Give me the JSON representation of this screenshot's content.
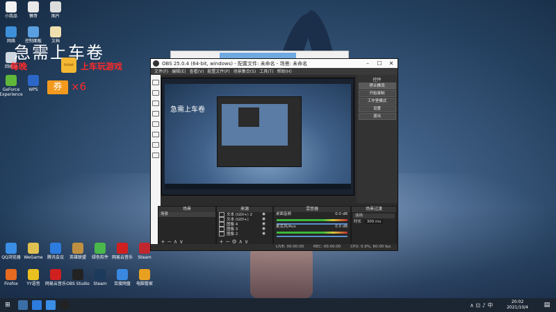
{
  "overlay": {
    "title": "急需上车卷",
    "left_red": "每晚",
    "ticket_label": "ticket",
    "right_red": "上车玩游戏",
    "coupon": "券",
    "multiplier": "×6"
  },
  "desktop_icons_top": [
    {
      "label": "小我品",
      "color": "#f2f2f2"
    },
    {
      "label": "懒哥",
      "color": "#e8e8e8"
    },
    {
      "label": "图片",
      "color": "#ddd"
    }
  ],
  "desktop_icons_left": [
    {
      "label": "网络",
      "color": "#3c8fd8"
    },
    {
      "label": "控制面板",
      "color": "#5aa0e0"
    },
    {
      "label": "文档",
      "color": "#f0e0b0"
    },
    {
      "label": "回收站",
      "color": "#cfd8e0"
    },
    {
      "label": "GeForce Experience",
      "color": "#5fb83a"
    },
    {
      "label": "WPS",
      "color": "#2c66c8"
    }
  ],
  "desktop_icons_bottom1": [
    {
      "label": "QQ浏览器",
      "color": "#3a8ee6"
    },
    {
      "label": "WeGame",
      "color": "#e0c050"
    },
    {
      "label": "腾讯会议",
      "color": "#2d7ce0"
    },
    {
      "label": "英雄联盟",
      "color": "#c09040"
    },
    {
      "label": "绿色软件",
      "color": "#4ab84a"
    },
    {
      "label": "网易云音乐",
      "color": "#d02020"
    },
    {
      "label": "Steam",
      "color": "#c0262e"
    }
  ],
  "desktop_icons_bottom2": [
    {
      "label": "Firefox",
      "color": "#e66a1f"
    },
    {
      "label": "YY语音",
      "color": "#e8c020"
    },
    {
      "label": "网易云音乐",
      "color": "#d02020"
    },
    {
      "label": "OBS Studio",
      "color": "#222"
    },
    {
      "label": "Steam",
      "color": "#1b3a5c"
    },
    {
      "label": "百度网盘",
      "color": "#3a88e0"
    },
    {
      "label": "电脑管家",
      "color": "#e8a020"
    }
  ],
  "obs": {
    "title": "OBS 25.0.4 (64-bit, windows) - 配置文件: 未命名 - 场景: 未命名",
    "menu": [
      "文件(F)",
      "编辑(E)",
      "查看(V)",
      "配置文件(P)",
      "场景集合(S)",
      "工具(T)",
      "帮助(H)"
    ],
    "preview_text": "急需上车卷",
    "controls": {
      "header": "控件",
      "buttons": [
        "停止推流",
        "开始录制",
        "工作室模式",
        "设置",
        "退出"
      ]
    },
    "docks": {
      "scenes": {
        "header": "场景",
        "items": [
          "场景"
        ]
      },
      "sources": {
        "header": "来源",
        "items": [
          "文本 (GDI+) 2",
          "文本 (GDI+)",
          "图像 4",
          "图像 3",
          "图像 2"
        ]
      },
      "mixer": {
        "header": "混音器",
        "tracks": [
          {
            "name": "桌面音频",
            "db": "0.0 dB"
          },
          {
            "name": "麦克风/Aux",
            "db": "0.0 dB"
          }
        ]
      },
      "transitions": {
        "header": "场景过渡",
        "type": "淡出",
        "duration_label": "时长",
        "duration": "300 ms"
      }
    },
    "status": {
      "live": "LIVE: 00:00:00",
      "rec": "REC: 00:00:00",
      "cpu": "CPU: 0.9%, 60.00 fps"
    }
  },
  "taskbar": {
    "time": "20:02",
    "date": "2021/10/4"
  }
}
